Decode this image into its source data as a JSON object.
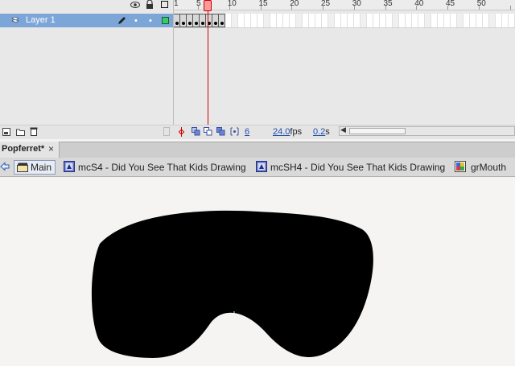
{
  "timeline": {
    "layer_name": "Layer 1",
    "ruler_labels": [
      "1",
      "5",
      "10",
      "15",
      "20",
      "25",
      "30",
      "35",
      "40",
      "45",
      "50"
    ],
    "current_frame": "6",
    "frame_rate": "24.0",
    "frame_rate_unit": "fps",
    "elapsed_time": "0.2",
    "elapsed_time_unit": "s"
  },
  "document": {
    "tab_title": "Popferret*",
    "close_glyph": "×"
  },
  "breadcrumb": {
    "items": [
      {
        "label": "Main",
        "icon": "scene-clapper-icon"
      },
      {
        "label": "mcS4 - Did You See That Kids Drawing",
        "icon": "movieclip-symbol-icon"
      },
      {
        "label": "mcSH4 - Did You See That Kids Drawing",
        "icon": "movieclip-symbol-icon"
      },
      {
        "label": "grMouth",
        "icon": "graphic-symbol-icon"
      }
    ]
  },
  "colors": {
    "selected_layer": "#7da6d8",
    "playhead": "#d40000",
    "shape_fill": "#000000",
    "outline_swatch": "#33cc66"
  }
}
